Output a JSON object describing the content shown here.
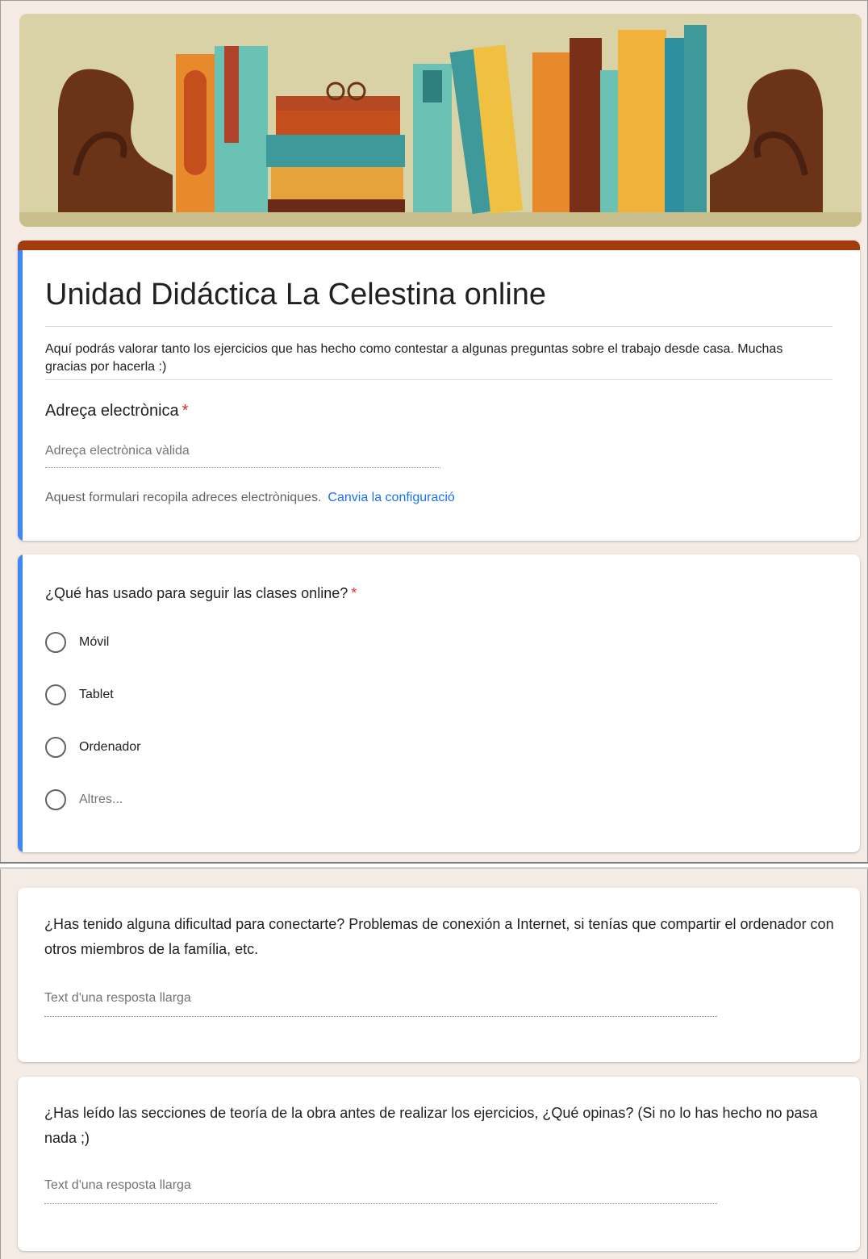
{
  "form": {
    "title": "Unidad Didáctica La Celestina online",
    "description": "Aquí podrás valorar tanto los ejercicios que has hecho como contestar a algunas preguntas sobre el trabajo desde casa. Muchas gracias por hacerla :)",
    "email": {
      "label": "Adreça electrònica",
      "required_mark": "*",
      "placeholder": "Adreça electrònica vàlida",
      "collect_note": "Aquest formulari recopila adreces electròniques.",
      "settings_link": "Canvia la configuració"
    }
  },
  "questions": {
    "device": {
      "label": "¿Qué has usado para seguir las clases online?",
      "required_mark": "*",
      "options": [
        "Móvil",
        "Tablet",
        "Ordenador",
        "Altres..."
      ]
    },
    "connection": {
      "label": "¿Has tenido alguna dificultad para conectarte? Problemas de conexión a Internet, si tenías que compartir el ordenador con otros miembros de la família, etc.",
      "placeholder": "Text d'una resposta llarga"
    },
    "theory": {
      "label": "¿Has leído las secciones de teoría de la obra antes de realizar los ejercicios, ¿Qué opinas?  (Si no lo has hecho no pasa nada ;)",
      "placeholder": "Text d'una resposta llarga"
    }
  },
  "colors": {
    "header_bar": "#a23c0c",
    "accent": "#4285f4",
    "required": "#d93025",
    "link": "#1a73e8",
    "background": "#f3ebe4"
  }
}
